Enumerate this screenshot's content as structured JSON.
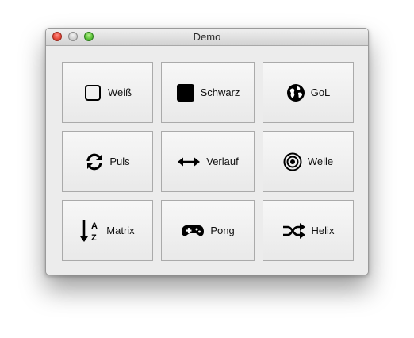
{
  "window": {
    "title": "Demo"
  },
  "buttons": [
    {
      "label": "Weiß",
      "icon": "checkbox-empty-icon"
    },
    {
      "label": "Schwarz",
      "icon": "black-square-icon"
    },
    {
      "label": "GoL",
      "icon": "globe-icon"
    },
    {
      "label": "Puls",
      "icon": "refresh-icon"
    },
    {
      "label": "Verlauf",
      "icon": "horizontal-arrows-icon"
    },
    {
      "label": "Welle",
      "icon": "target-icon"
    },
    {
      "label": "Matrix",
      "icon": "sort-az-icon"
    },
    {
      "label": "Pong",
      "icon": "gamepad-icon"
    },
    {
      "label": "Helix",
      "icon": "shuffle-icon"
    }
  ],
  "icon_glyphs": {
    "sort_a": "A",
    "sort_z": "Z"
  },
  "colors": {
    "titlebar_top": "#f0f0f0",
    "titlebar_bottom": "#d2d2d2",
    "window_bg": "#ececec",
    "button_border": "#aaaaaa",
    "close": "#e84c3d",
    "minimize": "#cfcfcf",
    "zoom": "#5fc43b"
  }
}
